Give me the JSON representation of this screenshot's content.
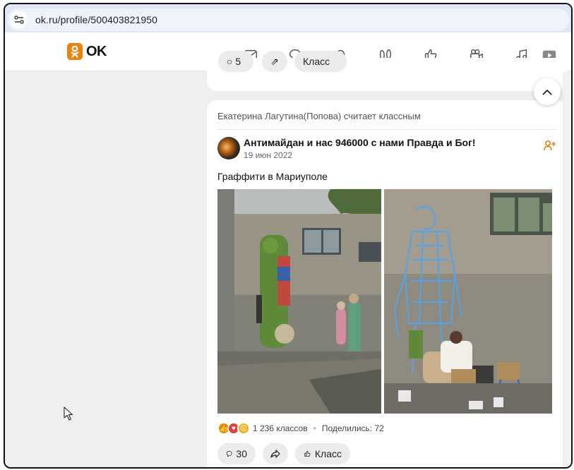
{
  "browser": {
    "url": "ok.ru/profile/500403821950"
  },
  "header": {
    "logo_text": "OK",
    "nav_icons": [
      "mail-icon",
      "chat-icon",
      "bell-icon",
      "guests-icon",
      "like-icon",
      "video-icon",
      "music-icon",
      "play-icon"
    ]
  },
  "prev_post": {
    "comments_label": "5",
    "like_label": "Класс"
  },
  "post": {
    "liked_by": "Екатерина Лагутина(Попова) считает классным",
    "group_name": "Антимайдан и нас 946000 с нами Правда и Бог!",
    "date": "19 июн 2022",
    "text": "Граффити в Мариуполе",
    "reactions": {
      "count_text": "1 236 классов",
      "shares_text": "Поделились: 72"
    },
    "actions": {
      "comments": "30",
      "like": "Класс"
    }
  },
  "colors": {
    "accent": "#ee8208",
    "background": "#efefef"
  }
}
